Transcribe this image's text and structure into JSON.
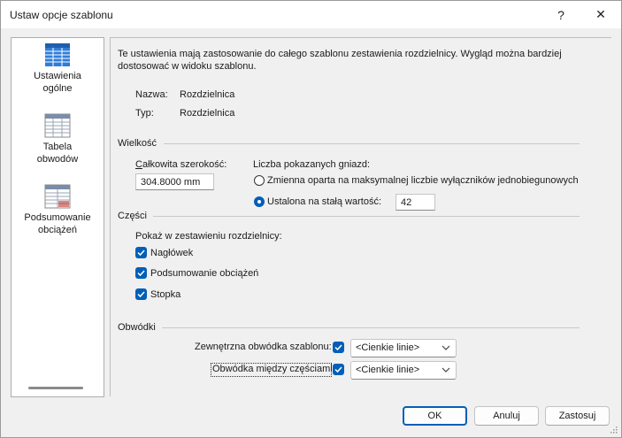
{
  "window": {
    "title": "Ustaw opcje szablonu",
    "help_glyph": "?",
    "close_glyph": "✕"
  },
  "sidebar": {
    "items": [
      {
        "label_line1": "Ustawienia",
        "label_line2": "ogólne",
        "icon": "general-settings-icon",
        "selected": true
      },
      {
        "label_line1": "Tabela",
        "label_line2": "obwodów",
        "icon": "circuit-table-icon",
        "selected": false
      },
      {
        "label_line1": "Podsumowanie",
        "label_line2": "obciążeń",
        "icon": "load-summary-icon",
        "selected": false
      }
    ]
  },
  "main": {
    "intro": "Te ustawienia mają zastosowanie do całego szablonu zestawienia rozdzielnicy. Wygląd można bardziej dostosować w widoku szablonu.",
    "name_label": "Nazwa:",
    "name_value": "Rozdzielnica",
    "type_label": "Typ:",
    "type_value": "Rozdzielnica",
    "size": {
      "title": "Wielkość",
      "total_width_label": "Całkowita szerokość:",
      "total_width_value": "304.8000 mm",
      "slots_label": "Liczba pokazanych gniazd:",
      "option_variable": "Zmienna oparta na maksymalnej liczbie wyłączników jednobiegunowych",
      "option_fixed": "Ustalona na stałą wartość:",
      "fixed_value": "42",
      "selected_option": "fixed"
    },
    "parts": {
      "title": "Części",
      "show_label": "Pokaż w zestawieniu rozdzielnicy:",
      "header_label": "Nagłówek",
      "header_checked": true,
      "load_summary_label": "Podsumowanie obciążeń",
      "load_summary_checked": true,
      "footer_label": "Stopka",
      "footer_checked": true
    },
    "borders": {
      "title": "Obwódki",
      "outer_label": "Zewnętrzna obwódka szablonu:",
      "outer_checked": true,
      "outer_value": "<Cienkie linie>",
      "between_label": "Obwódka między częściami:",
      "between_checked": true,
      "between_value": "<Cienkie linie>"
    }
  },
  "buttons": {
    "ok": "OK",
    "cancel": "Anuluj",
    "apply": "Zastosuj"
  },
  "colors": {
    "accent": "#005fb8",
    "icon_blue": "#2f7ed8"
  }
}
